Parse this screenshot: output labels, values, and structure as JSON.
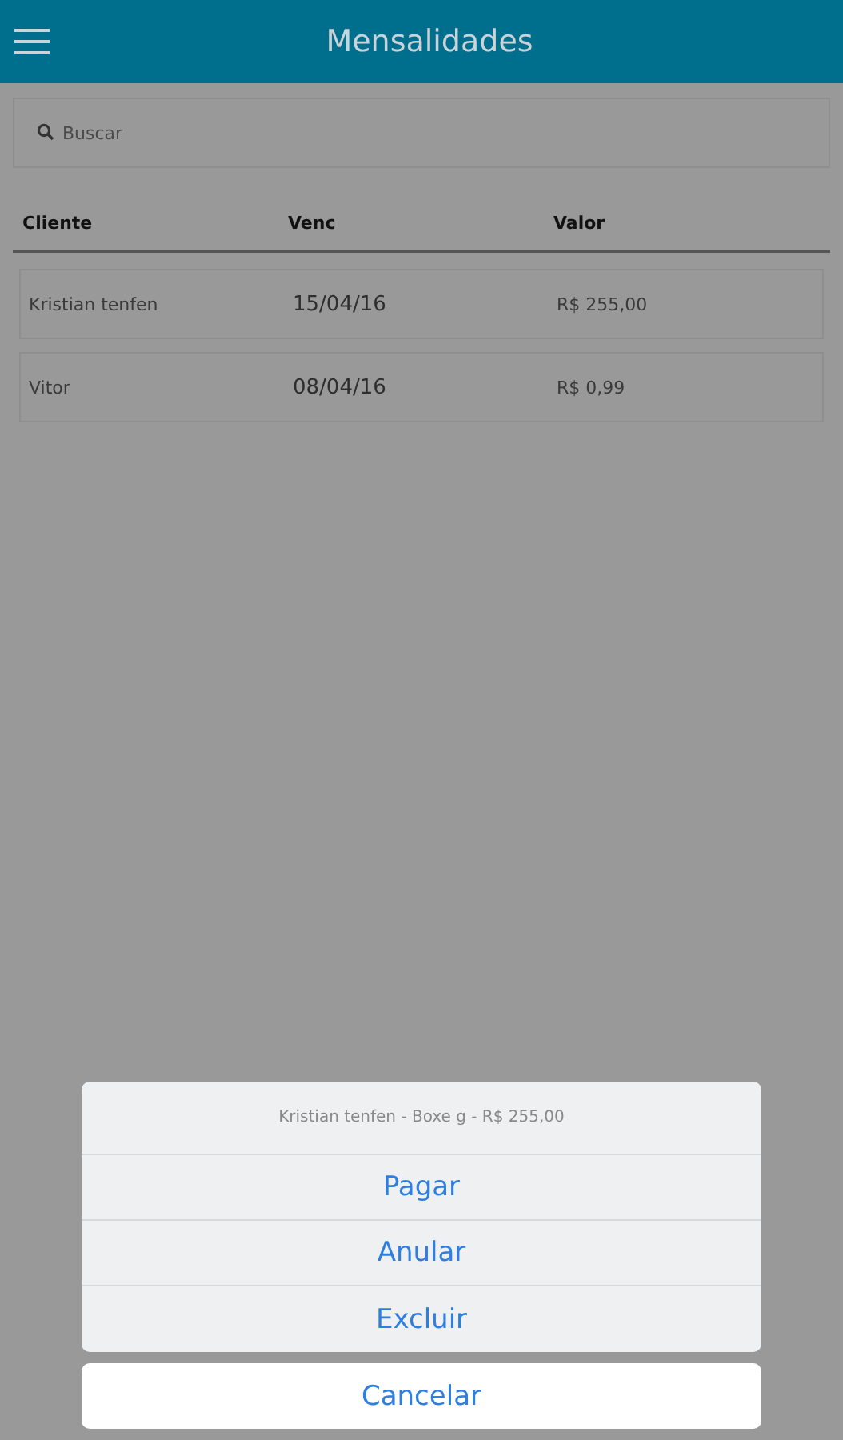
{
  "header": {
    "title": "Mensalidades"
  },
  "search": {
    "placeholder": "Buscar"
  },
  "table": {
    "columns": [
      "Cliente",
      "Venc",
      "Valor"
    ],
    "rows": [
      {
        "cells": [
          "Kristian tenfen",
          "15/04/16",
          "R$ 255,00"
        ]
      },
      {
        "cells": [
          "Vitor",
          "08/04/16",
          "R$ 0,99"
        ]
      }
    ]
  },
  "action_sheet": {
    "title": "Kristian tenfen - Boxe g - R$ 255,00",
    "actions": [
      "Pagar",
      "Anular",
      "Excluir"
    ],
    "cancel": "Cancelar"
  }
}
